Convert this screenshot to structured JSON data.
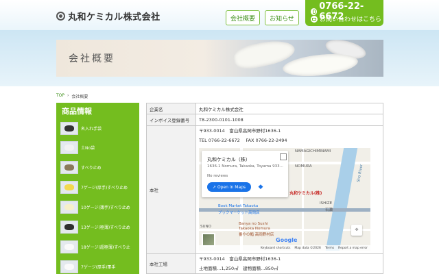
{
  "header": {
    "company_name": "丸和ケミカル株式会社",
    "nav": [
      {
        "label": "会社概要"
      },
      {
        "label": "お知らせ"
      }
    ],
    "tel": "0766-22-6672",
    "inquiry": "お問い合わせはこちら",
    "accent_color": "#74bd1f"
  },
  "banner": {
    "title": "会社概要"
  },
  "breadcrumb": {
    "top": "TOP",
    "separator": "›",
    "current": "会社概要"
  },
  "sidebar": {
    "title": "商品情報",
    "items": [
      {
        "label": "名入れ手袋",
        "icon": "glove-black-icon"
      },
      {
        "label": "土No袋",
        "icon": "bag-icon"
      },
      {
        "label": "すべり止め",
        "icon": "glove-dotted-icon"
      },
      {
        "label": "7ゲージ(厚手)すべり止め",
        "icon": "glove-yellow-icon"
      },
      {
        "label": "10ゲージ(薄手)すべり止め",
        "icon": "glove-white-icon"
      },
      {
        "label": "13ゲージ(極薄)すべり止め",
        "icon": "glove-dark-icon"
      },
      {
        "label": "18ゲージ(超極薄)すべり止",
        "icon": "glove-white-icon"
      },
      {
        "label": "7ゲージ(厚手)軍手",
        "icon": "glove-white-icon"
      }
    ]
  },
  "info": {
    "rows": [
      {
        "label": "企業名",
        "value": "丸和ケミカル株式会社"
      },
      {
        "label": "インボイス登録番号",
        "value": "T8-2300-0101-1008"
      }
    ],
    "head_office": {
      "label": "本社",
      "postal": "〒933-0014　富山県高岡市野村1636-1",
      "tel_fax": "TEL 0766-22-6672　 FAX 0766-22-2494"
    },
    "factory": {
      "label": "本社工場",
      "postal": "〒933-0014　富山県高岡市野村1636-1",
      "area": "土地面積…1,250㎡　建物面積…850㎡"
    }
  },
  "map": {
    "card_name": "丸和ケミカル（株）",
    "card_address": "1636-1 Nomura, Takaoka, Toyama 933...",
    "reviews": "No reviews",
    "open_label": "Open in Maps",
    "pin_label": "丸和ケミカル(株)",
    "labels": {
      "nomura": "NOMURA",
      "namagichiminami": "NAMAGICHIMINAMI",
      "ishize": "ISHIZE",
      "river": "Sho River",
      "book": "Book Market Takaoka",
      "book_jp": "ブックマーケット高岡店",
      "banya": "Banya no Sushi",
      "banya2": "Takaoka Nomura",
      "banya_jp": "番やの鮨 高岡野村店",
      "suno": "SUNO",
      "ishize_jp": "石瀬"
    },
    "footer": [
      "Keyboard shortcuts",
      "Map data ©2026",
      "Terms",
      "Report a map error"
    ],
    "google": "Google"
  }
}
